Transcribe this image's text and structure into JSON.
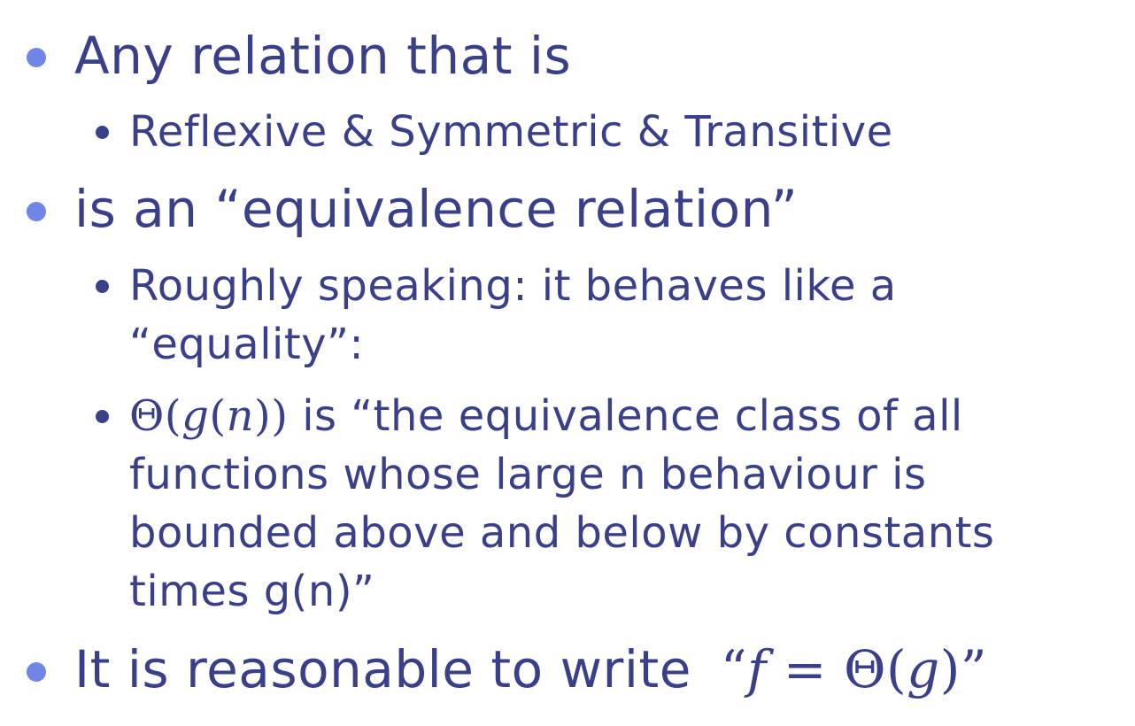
{
  "bullets": [
    {
      "text": "Any relation that is",
      "children": [
        {
          "text": "Reflexive & Symmetric  & Transitive"
        }
      ]
    },
    {
      "text": "is an “equivalence relation”",
      "children": [
        {
          "lines": [
            "Roughly speaking: it behaves like a",
            "“equality”:"
          ]
        },
        {
          "math": {
            "theta": "Θ",
            "open": "(",
            "g": "g",
            "open2": "(",
            "n": "n",
            "close": "))"
          },
          "lines": [
            " is “the equivalence class of all",
            "functions whose large n behaviour is",
            "bounded above and below by constants",
            "times g(n)”"
          ]
        }
      ]
    },
    {
      "text": "It is reasonable to write ",
      "math": {
        "open_quote": "“",
        "f": "f",
        "eq": " = ",
        "theta": "Θ",
        "open": "(",
        "g": "g",
        "close": ")",
        "close_quote": "”"
      }
    }
  ],
  "colors": {
    "text": "#3a3f8a",
    "level1_bullet": "#6f86e6",
    "level2_bullet": "#3a3f8a"
  }
}
